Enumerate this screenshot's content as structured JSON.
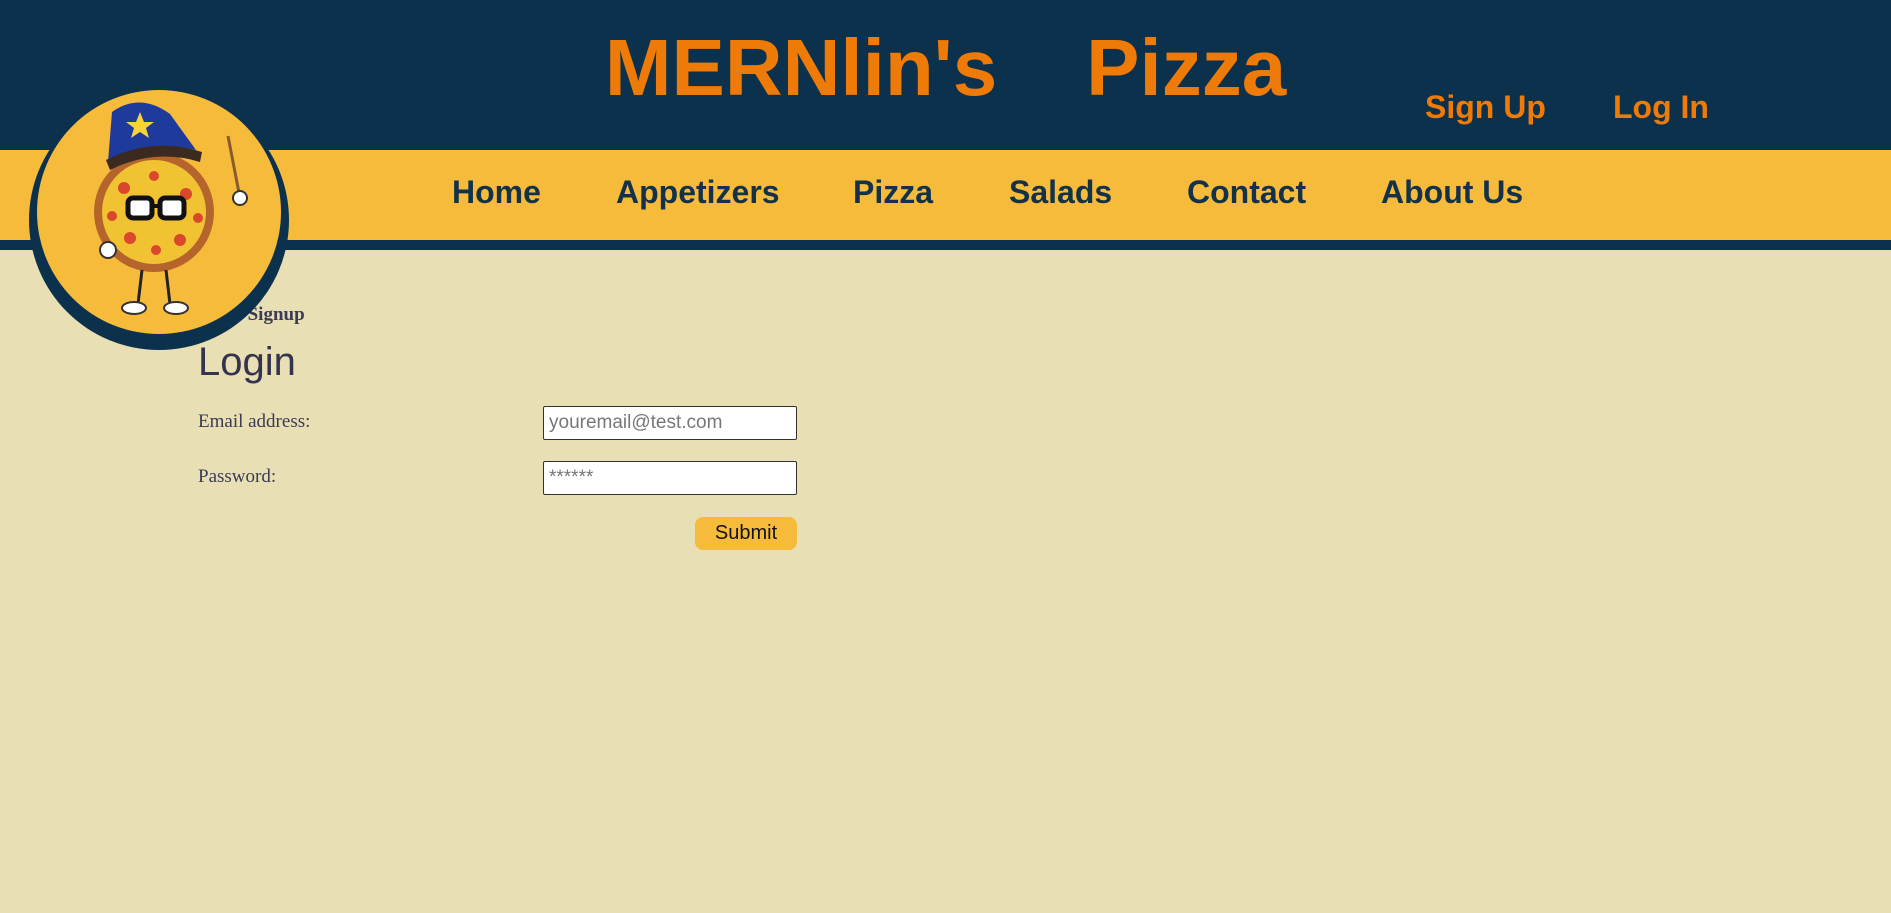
{
  "header": {
    "title": "MERNlin's    Pizza",
    "signup_label": "Sign Up",
    "login_label": "Log In"
  },
  "nav": {
    "items": [
      "Home",
      "Appetizers",
      "Pizza",
      "Salads",
      "Contact",
      "About Us"
    ]
  },
  "main": {
    "back_link": "Go to Signup",
    "heading": "Login",
    "email_label": "Email address:",
    "email_placeholder": "youremail@test.com",
    "password_label": "Password:",
    "password_placeholder": "******",
    "submit_label": "Submit"
  },
  "colors": {
    "header_bg": "#0b314c",
    "accent_orange": "#ee7a08",
    "nav_bg": "#f6bb3b",
    "page_bg": "#e8dfb4",
    "nav_text": "#13324a"
  },
  "icons": {
    "logo": "wizard-pizza-mascot-logo"
  }
}
